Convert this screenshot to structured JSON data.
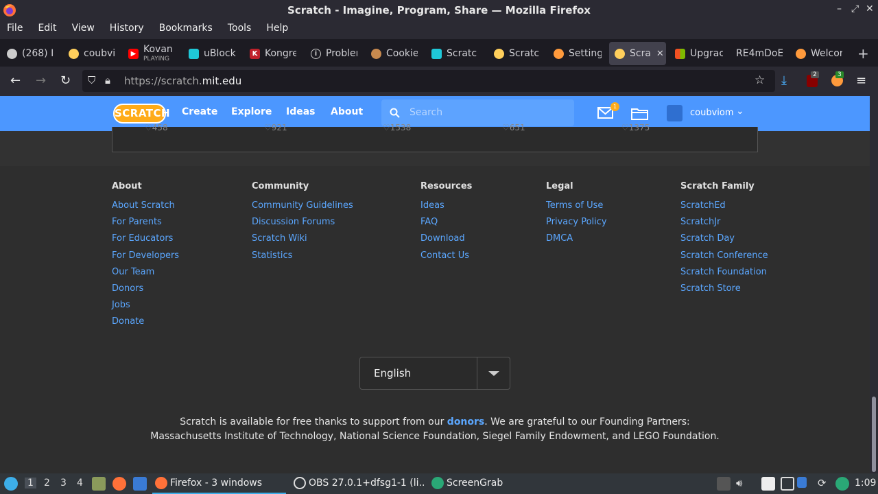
{
  "window": {
    "title": "Scratch - Imagine, Program, Share — Mozilla Firefox",
    "controls": [
      "–",
      "⤢",
      "✕"
    ]
  },
  "menu": [
    "File",
    "Edit",
    "View",
    "History",
    "Bookmarks",
    "Tools",
    "Help"
  ],
  "tabs": [
    {
      "label": "(268) I",
      "icon": "github-icon",
      "color": "#cccccc"
    },
    {
      "label": "coubvi",
      "icon": "scratch-cat-icon",
      "color": "#ffcf5c"
    },
    {
      "label": "Kovan",
      "sub": "PLAYING",
      "icon": "youtube-icon",
      "color": "#ff0000"
    },
    {
      "label": "uBlock",
      "icon": "ublock-icon",
      "color": "#1fc8d8"
    },
    {
      "label": "Kongre",
      "icon": "kongregate-icon",
      "color": "#c0212a"
    },
    {
      "label": "Probler",
      "icon": "info-icon",
      "color": "#cccccc"
    },
    {
      "label": "Cookie",
      "icon": "cookie-icon",
      "color": "#c88a4f"
    },
    {
      "label": "Scratc",
      "icon": "scratch-cat-icon",
      "color": "#1fc8d8"
    },
    {
      "label": "Scratc",
      "icon": "scratch-cat-icon",
      "color": "#ffcf5c"
    },
    {
      "label": "Setting",
      "icon": "scratch-addons-icon",
      "color": "#ff9a3c"
    },
    {
      "label": "Scra",
      "icon": "scratch-cat-icon",
      "color": "#ffcf5c",
      "active": true
    },
    {
      "label": "Upgrac",
      "icon": "microsoft-icon",
      "color": "#00a4ef"
    },
    {
      "label": "RE4mDoE",
      "icon": "",
      "color": "#cccccc"
    },
    {
      "label": "Welcor",
      "icon": "scratch-addons-icon",
      "color": "#ff9a3c"
    }
  ],
  "address": {
    "prefix": "https://scratch.",
    "domain": "mit.edu"
  },
  "toolbar_badges": {
    "ublock": "2",
    "addons": "3"
  },
  "scratch_nav": {
    "logo": "SCRATCH",
    "create": "Create",
    "explore": "Explore",
    "ideas": "Ideas",
    "about": "About",
    "search_placeholder": "Search",
    "messages_count": "1",
    "username": "coubviom"
  },
  "project_loves": [
    "458",
    "921",
    "1538",
    "651",
    "1375"
  ],
  "footer": {
    "about": {
      "title": "About",
      "links": [
        "About Scratch",
        "For Parents",
        "For Educators",
        "For Developers",
        "Our Team",
        "Donors",
        "Jobs",
        "Donate"
      ]
    },
    "community": {
      "title": "Community",
      "links": [
        "Community Guidelines",
        "Discussion Forums",
        "Scratch Wiki",
        "Statistics"
      ]
    },
    "resources": {
      "title": "Resources",
      "links": [
        "Ideas",
        "FAQ",
        "Download",
        "Contact Us"
      ]
    },
    "legal": {
      "title": "Legal",
      "links": [
        "Terms of Use",
        "Privacy Policy",
        "DMCA"
      ]
    },
    "family": {
      "title": "Scratch Family",
      "links": [
        "ScratchEd",
        "ScratchJr",
        "Scratch Day",
        "Scratch Conference",
        "Scratch Foundation",
        "Scratch Store"
      ]
    },
    "language": "English",
    "credits_line1_a": "Scratch is available for free thanks to support from our ",
    "credits_donors": "donors",
    "credits_line1_b": ". We are grateful to our Founding Partners:",
    "credits_line2": "Massachusetts Institute of Technology, National Science Foundation, Siegel Family Endowment, and LEGO Foundation."
  },
  "taskbar": {
    "workspaces": [
      "1",
      "2",
      "3",
      "4"
    ],
    "tasks": [
      "Firefox - 3 windows",
      "OBS 27.0.1+dfsg1-1 (li...",
      "ScreenGrab"
    ],
    "clock": "1:09"
  },
  "colors": {
    "scratch_blue": "#4c97ff",
    "link": "#5ba7ff",
    "scratch_orange": "#ffab19"
  }
}
